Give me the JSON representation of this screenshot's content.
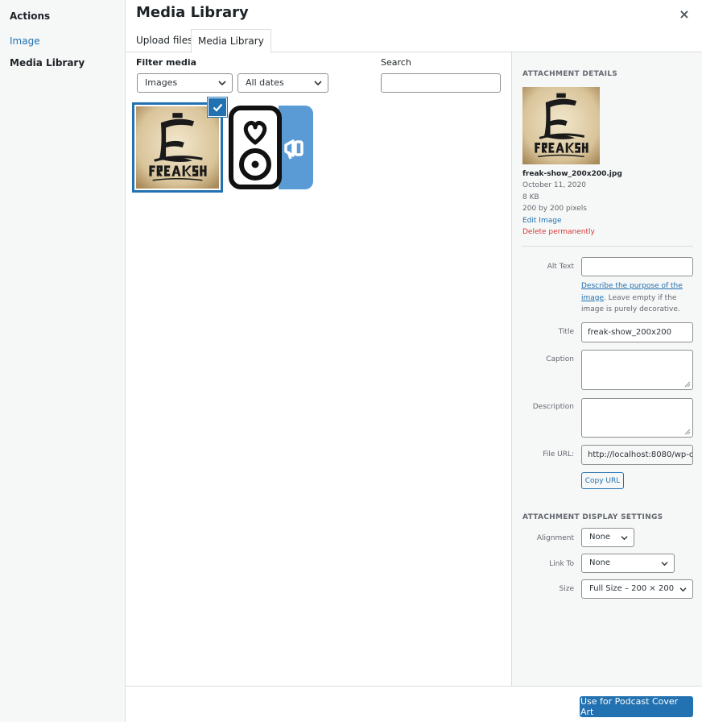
{
  "sidebar": {
    "heading": "Actions",
    "items": [
      {
        "label": "Image"
      },
      {
        "label": "Media Library"
      }
    ]
  },
  "header": {
    "title": "Media Library",
    "close_icon": "×"
  },
  "tabs": [
    {
      "label": "Upload files"
    },
    {
      "label": "Media Library",
      "active": true
    }
  ],
  "filters": {
    "label": "Filter media",
    "type_value": "Images",
    "date_value": "All dates",
    "search_label": "Search",
    "search_value": ""
  },
  "grid": {
    "items": [
      {
        "icon": "freak-show-logo",
        "selected": true
      },
      {
        "icon": "speaker-megaphone-logo",
        "selected": false
      }
    ]
  },
  "details": {
    "heading": "ATTACHMENT DETAILS",
    "filename": "freak-show_200x200.jpg",
    "date": "October 11, 2020",
    "size": "8 KB",
    "dimensions": "200 by 200 pixels",
    "edit_link": "Edit Image",
    "delete_link": "Delete permanently",
    "alt_label": "Alt Text",
    "alt_value": "",
    "alt_help_link": "Describe the purpose of the image",
    "alt_help_text": ". Leave empty if the image is purely decorative.",
    "title_label": "Title",
    "title_value": "freak-show_200x200",
    "caption_label": "Caption",
    "caption_value": "",
    "description_label": "Description",
    "description_value": "",
    "url_label": "File URL:",
    "url_value": "http://localhost:8080/wp-c",
    "copy_button": "Copy URL"
  },
  "display_settings": {
    "heading": "ATTACHMENT DISPLAY SETTINGS",
    "alignment_label": "Alignment",
    "alignment_value": "None",
    "link_label": "Link To",
    "link_value": "None",
    "size_label": "Size",
    "size_value": "Full Size – 200 × 200"
  },
  "footer": {
    "primary_button": "Use for Podcast Cover Art"
  },
  "colors": {
    "accent": "#2271b1",
    "danger": "#d63638",
    "panel_bg": "#f6f7f7"
  }
}
